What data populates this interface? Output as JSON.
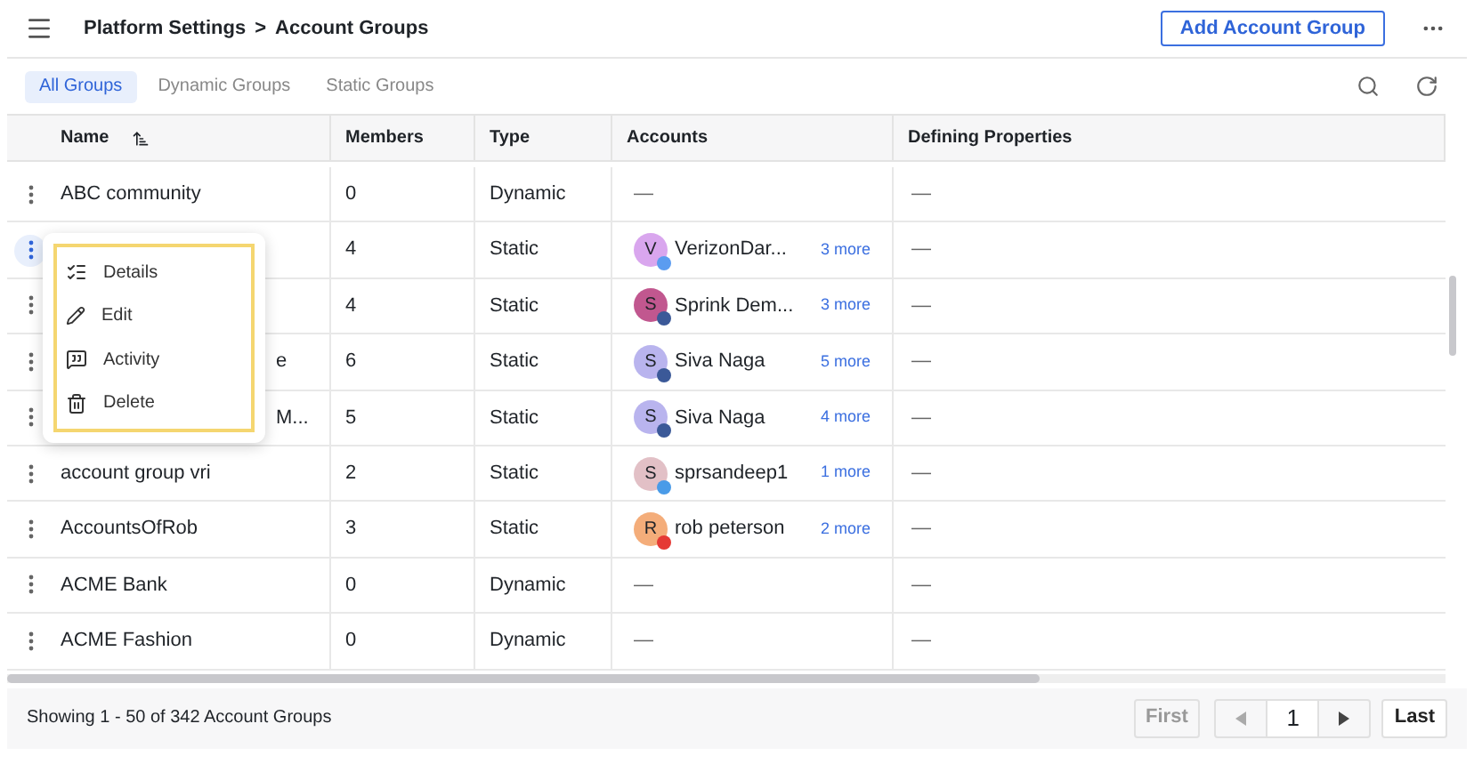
{
  "header": {
    "breadcrumb": [
      "Platform Settings",
      "Account Groups"
    ],
    "separator": ">",
    "primary_button": "Add Account Group"
  },
  "tabs": [
    {
      "label": "All Groups",
      "selected": true
    },
    {
      "label": "Dynamic Groups",
      "selected": false
    },
    {
      "label": "Static Groups",
      "selected": false
    }
  ],
  "table": {
    "columns": [
      "Name",
      "Members",
      "Type",
      "Accounts",
      "Defining Properties"
    ],
    "rows": [
      {
        "name": "ABC community",
        "members": "0",
        "type": "Dynamic",
        "menu_open": false,
        "defining": "—",
        "accounts_empty": "—"
      },
      {
        "members": "4",
        "type": "Static",
        "menu_open": true,
        "defining": "—",
        "account": {
          "initial": "V",
          "name": "VerizonDar...",
          "more": "3 more",
          "color": "#d9a6ee",
          "badge": {
            "color": "#5b9cf0"
          }
        }
      },
      {
        "members": "4",
        "type": "Static",
        "menu_open": false,
        "defining": "—",
        "account": {
          "initial": "S",
          "name": "Sprink Dem...",
          "more": "3 more",
          "color": "#c1578f",
          "badge": {
            "color": "#3b5998"
          }
        }
      },
      {
        "name": "e",
        "members": "6",
        "type": "Static",
        "menu_open": false,
        "defining": "—",
        "account": {
          "initial": "S",
          "name": "Siva Naga",
          "more": "5 more",
          "color": "#b9b4ee",
          "badge": {
            "color": "#3b5998"
          }
        }
      },
      {
        "name": "M...",
        "members": "5",
        "type": "Static",
        "menu_open": false,
        "defining": "—",
        "account": {
          "initial": "S",
          "name": "Siva Naga",
          "more": "4 more",
          "color": "#b9b4ee",
          "badge": {
            "color": "#3b5998"
          }
        }
      },
      {
        "name": "account group vri",
        "members": "2",
        "type": "Static",
        "menu_open": false,
        "defining": "—",
        "account": {
          "initial": "S",
          "name": "sprsandeep1",
          "more": "1 more",
          "color": "#e2c0c6",
          "badge": {
            "color": "#4a9be8"
          }
        }
      },
      {
        "name": "AccountsOfRob",
        "members": "3",
        "type": "Static",
        "menu_open": false,
        "defining": "—",
        "account": {
          "initial": "R",
          "name": "rob peterson",
          "more": "2 more",
          "color": "#f4ad7a",
          "badge": {
            "color": "#e53935"
          }
        }
      },
      {
        "name": "ACME Bank",
        "members": "0",
        "type": "Dynamic",
        "menu_open": false,
        "defining": "—",
        "accounts_empty": "—"
      },
      {
        "name": "ACME Fashion",
        "members": "0",
        "type": "Dynamic",
        "menu_open": false,
        "defining": "—",
        "accounts_empty": "—"
      }
    ]
  },
  "row_menu": [
    {
      "kind": "details",
      "label": "Details"
    },
    {
      "kind": "edit",
      "label": "Edit"
    },
    {
      "kind": "activity",
      "label": "Activity"
    },
    {
      "kind": "delete",
      "label": "Delete"
    }
  ],
  "footer": {
    "summary": "Showing 1 - 50 of 342 Account Groups",
    "first": {
      "label": "First",
      "disabled": true
    },
    "prev_disabled": true,
    "page": "1",
    "next_disabled": false,
    "last": {
      "label": "Last",
      "disabled": false
    }
  }
}
